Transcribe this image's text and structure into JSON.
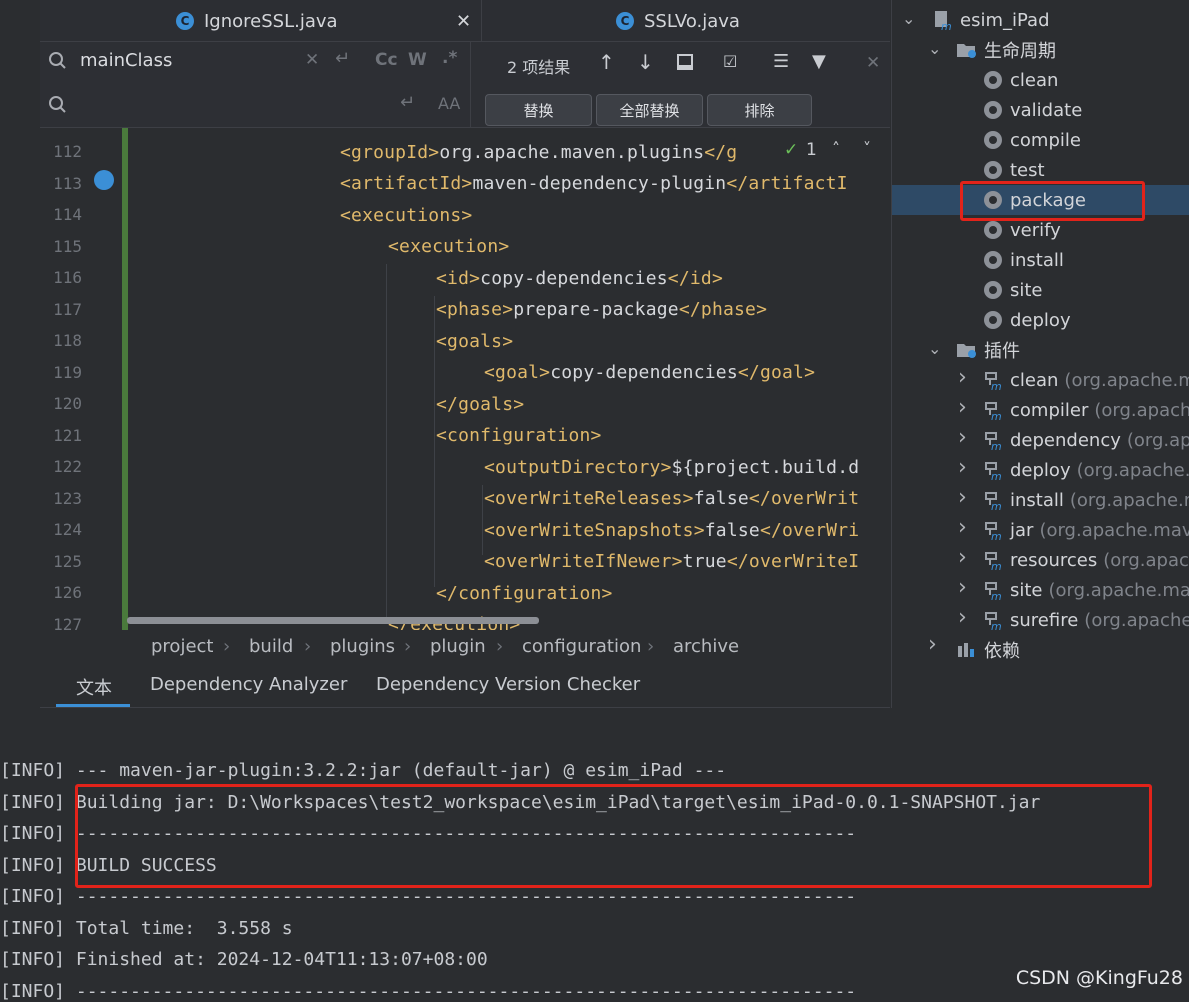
{
  "tabs": [
    {
      "label": "IgnoreSSL.java",
      "icon": "c-class-icon"
    },
    {
      "label": "SSLVo.java",
      "icon": "c-class-icon"
    }
  ],
  "find": {
    "search_value": "mainClass",
    "replace_value": "",
    "result_count": "2 项结果",
    "replace_label": "替换",
    "replace_all_label": "全部替换",
    "exclude_label": "排除",
    "match_case": "Cc",
    "word": "W",
    "regex": ".*",
    "ok_count": "1"
  },
  "code": {
    "line_numbers": [
      "112",
      "113",
      "114",
      "115",
      "116",
      "117",
      "118",
      "119",
      "120",
      "121",
      "122",
      "123",
      "124",
      "125",
      "126",
      "127"
    ],
    "lines": [
      {
        "indent": "",
        "parts": []
      },
      {
        "parts": [
          [
            "tg",
            "<groupId>"
          ],
          [
            "tx",
            "org.apache.maven.plugins"
          ],
          [
            "tg",
            "</g"
          ]
        ]
      },
      {
        "parts": [
          [
            "tg",
            "<artifactId>"
          ],
          [
            "tx",
            "maven-dependency-plugin"
          ],
          [
            "tg",
            "</artifactI"
          ]
        ]
      },
      {
        "parts": [
          [
            "tg",
            "<executions>"
          ]
        ]
      },
      {
        "parts": [
          [
            "tg",
            "<execution>"
          ]
        ]
      },
      {
        "parts": [
          [
            "tg",
            "<id>"
          ],
          [
            "tx",
            "copy-dependencies"
          ],
          [
            "tg",
            "</id>"
          ]
        ]
      },
      {
        "parts": [
          [
            "tg",
            "<phase>"
          ],
          [
            "tx",
            "prepare-package"
          ],
          [
            "tg",
            "</phase>"
          ]
        ]
      },
      {
        "parts": [
          [
            "tg",
            "<goals>"
          ]
        ]
      },
      {
        "parts": [
          [
            "tg",
            "<goal>"
          ],
          [
            "tx",
            "copy-dependencies"
          ],
          [
            "tg",
            "</goal>"
          ]
        ]
      },
      {
        "parts": [
          [
            "tg",
            "</goals>"
          ]
        ]
      },
      {
        "parts": [
          [
            "tg",
            "<configuration>"
          ]
        ]
      },
      {
        "parts": [
          [
            "tg",
            "<outputDirectory>"
          ],
          [
            "tx",
            "${project.build.d"
          ]
        ]
      },
      {
        "parts": [
          [
            "tg",
            "<overWriteReleases>"
          ],
          [
            "tx",
            "false"
          ],
          [
            "tg",
            "</overWrit"
          ]
        ]
      },
      {
        "parts": [
          [
            "tg",
            "<overWriteSnapshots>"
          ],
          [
            "tx",
            "false"
          ],
          [
            "tg",
            "</overWri"
          ]
        ]
      },
      {
        "parts": [
          [
            "tg",
            "<overWriteIfNewer>"
          ],
          [
            "tx",
            "true"
          ],
          [
            "tg",
            "</overWriteI"
          ]
        ]
      },
      {
        "parts": [
          [
            "tg",
            "</configuration>"
          ]
        ]
      },
      {
        "parts": [
          [
            "tg",
            "</execution>"
          ]
        ]
      }
    ]
  },
  "breadcrumb": [
    "project",
    "build",
    "plugins",
    "plugin",
    "configuration",
    "archive"
  ],
  "bottom_tabs": [
    "文本",
    "Dependency Analyzer",
    "Dependency Version Checker"
  ],
  "maven": {
    "root": "esim_iPad",
    "lifecycle_label": "生命周期",
    "lifecycle": [
      "clean",
      "validate",
      "compile",
      "test",
      "package",
      "verify",
      "install",
      "site",
      "deploy"
    ],
    "selected": "package",
    "plugins_label": "插件",
    "plugins": [
      {
        "name": "clean",
        "group": "(org.apache.ma"
      },
      {
        "name": "compiler",
        "group": "(org.apache"
      },
      {
        "name": "dependency",
        "group": "(org.apa"
      },
      {
        "name": "deploy",
        "group": "(org.apache.m"
      },
      {
        "name": "install",
        "group": "(org.apache.m"
      },
      {
        "name": "jar",
        "group": "(org.apache.mave"
      },
      {
        "name": "resources",
        "group": "(org.apache"
      },
      {
        "name": "site",
        "group": "(org.apache.mave"
      },
      {
        "name": "surefire",
        "group": "(org.apache.m"
      }
    ],
    "deps_label": "依赖"
  },
  "console": [
    "[INFO] --- maven-jar-plugin:3.2.2:jar (default-jar) @ esim_iPad ---",
    "[INFO] Building jar: D:\\Workspaces\\test2_workspace\\esim_iPad\\target\\esim_iPad-0.0.1-SNAPSHOT.jar",
    "[INFO] ------------------------------------------------------------------------",
    "[INFO] BUILD SUCCESS",
    "[INFO] ------------------------------------------------------------------------",
    "[INFO] Total time:  3.558 s",
    "[INFO] Finished at: 2024-12-04T11:13:07+08:00",
    "[INFO] ------------------------------------------------------------------------"
  ],
  "watermark": "CSDN @KingFu28",
  "colors": {
    "accent": "#3b8fd6",
    "highlight": "#e2231a",
    "tag": "#e0b96b",
    "selection": "#2e4a66"
  }
}
